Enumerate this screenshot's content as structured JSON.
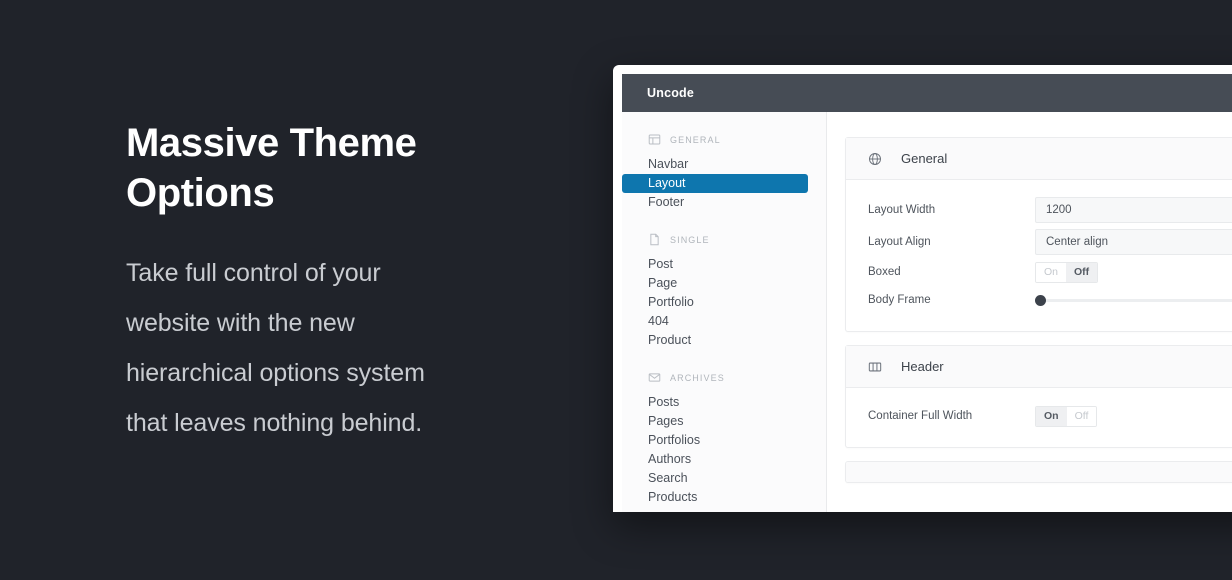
{
  "hero": {
    "title_line1": "Massive Theme",
    "title_line2": "Options",
    "body": "Take full control of your website with the new hierarchical options system that leaves nothing behind."
  },
  "window": {
    "titlebar": {
      "title": "Uncode"
    },
    "sidebar": {
      "groups": [
        {
          "label": "GENERAL",
          "icon": "layout-icon",
          "items": [
            {
              "label": "Navbar",
              "active": false
            },
            {
              "label": "Layout",
              "active": true
            },
            {
              "label": "Footer",
              "active": false
            }
          ]
        },
        {
          "label": "SINGLE",
          "icon": "document-icon",
          "items": [
            {
              "label": "Post",
              "active": false
            },
            {
              "label": "Page",
              "active": false
            },
            {
              "label": "Portfolio",
              "active": false
            },
            {
              "label": "404",
              "active": false
            },
            {
              "label": "Product",
              "active": false
            }
          ]
        },
        {
          "label": "ARCHIVES",
          "icon": "inbox-icon",
          "items": [
            {
              "label": "Posts",
              "active": false
            },
            {
              "label": "Pages",
              "active": false
            },
            {
              "label": "Portfolios",
              "active": false
            },
            {
              "label": "Authors",
              "active": false
            },
            {
              "label": "Search",
              "active": false
            },
            {
              "label": "Products",
              "active": false
            }
          ]
        }
      ]
    },
    "cards": [
      {
        "title": "General",
        "icon": "globe-icon",
        "fields": [
          {
            "label": "Layout Width",
            "type": "text",
            "value": "1200"
          },
          {
            "label": "Layout Align",
            "type": "select",
            "value": "Center align"
          },
          {
            "label": "Boxed",
            "type": "toggle",
            "on_label": "On",
            "off_label": "Off",
            "value": "Off"
          },
          {
            "label": "Body Frame",
            "type": "slider",
            "value": "0"
          }
        ]
      },
      {
        "title": "Header",
        "icon": "columns-icon",
        "fields": [
          {
            "label": "Container Full Width",
            "type": "toggle",
            "on_label": "On",
            "off_label": "Off",
            "value": "On"
          }
        ]
      }
    ]
  },
  "colors": {
    "background": "#20232a",
    "accent": "#0e76ae",
    "titlebar": "#464c55",
    "panel": "#ffffff"
  }
}
